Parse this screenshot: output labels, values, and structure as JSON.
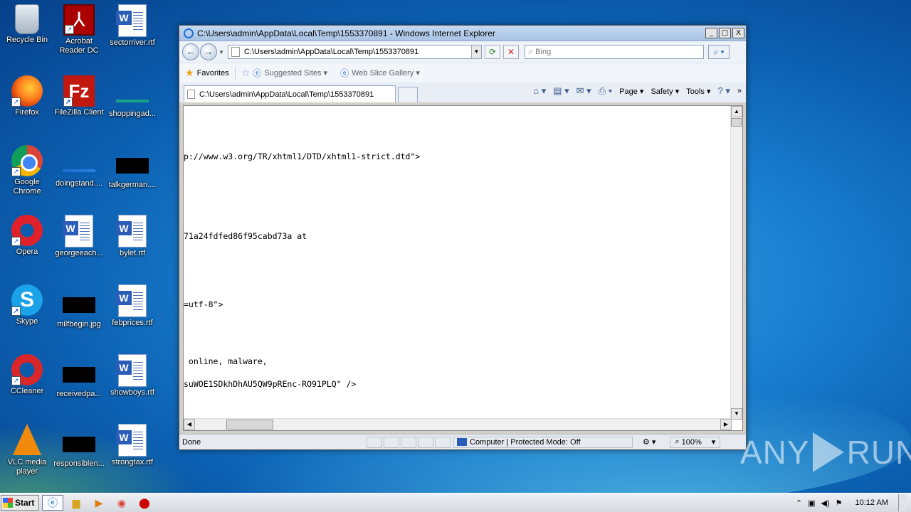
{
  "desktop": {
    "icons": [
      {
        "label": "Recycle Bin"
      },
      {
        "label": "Acrobat Reader DC"
      },
      {
        "label": "sectorriver.rtf"
      },
      {
        "label": "Firefox"
      },
      {
        "label": "FileZilla Client"
      },
      {
        "label": "shoppingad..."
      },
      {
        "label": "Google Chrome"
      },
      {
        "label": "doingstand...."
      },
      {
        "label": "talkgerman...."
      },
      {
        "label": "Opera"
      },
      {
        "label": "georgeeach..."
      },
      {
        "label": "bylet.rtf"
      },
      {
        "label": "Skype"
      },
      {
        "label": "milfbegin.jpg"
      },
      {
        "label": "febprices.rtf"
      },
      {
        "label": "CCleaner"
      },
      {
        "label": "receivedpa..."
      },
      {
        "label": "showboys.rtf"
      },
      {
        "label": "VLC media player"
      },
      {
        "label": "responsiblen..."
      },
      {
        "label": "strongtax.rtf"
      }
    ]
  },
  "window": {
    "title": "C:\\Users\\admin\\AppData\\Local\\Temp\\1553370891 - Windows Internet Explorer",
    "controls": {
      "minimize": "_",
      "maximize": "□",
      "close": "X"
    }
  },
  "address": {
    "value": "C:\\Users\\admin\\AppData\\Local\\Temp\\1553370891",
    "search_placeholder": "Bing"
  },
  "favorites": {
    "label": "Favorites",
    "items": [
      "Suggested Sites ▾",
      "Web Slice Gallery ▾"
    ]
  },
  "tabs": {
    "active": "C:\\Users\\admin\\AppData\\Local\\Temp\\1553370891"
  },
  "commands": {
    "page": "Page ▾",
    "safety": "Safety ▾",
    "tools": "Tools ▾"
  },
  "content": {
    "lines": [
      "p://www.w3.org/TR/xhtml1/DTD/xhtml1-strict.dtd\">",
      "71a24fdfed86f95cabd73a at",
      "=utf-8\">",
      " online, malware,",
      "suWOE1SDkhDhAU5QW9pREnc-RO91PLQ\" />"
    ]
  },
  "status": {
    "text": "Done",
    "zone": "Computer | Protected Mode: Off",
    "zoom": "100%"
  },
  "taskbar": {
    "start": "Start",
    "clock": "10:12 AM"
  },
  "watermark": {
    "left": "ANY",
    "right": "RUN"
  }
}
